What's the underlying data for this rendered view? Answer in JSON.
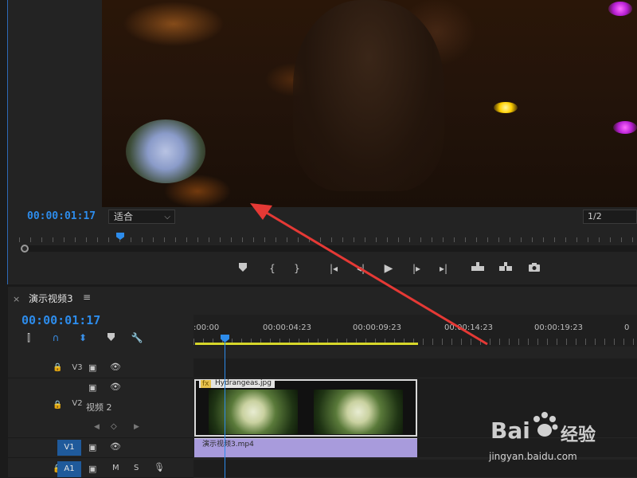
{
  "program_monitor": {
    "timecode": "00:00:01:17",
    "zoom": "适合",
    "resolution": "1/2"
  },
  "timeline": {
    "close": "×",
    "sequence_name": "演示视频3",
    "menu": "≡",
    "timecode": "00:00:01:17",
    "ruler_labels": [
      ":00:00",
      "00:00:04:23",
      "00:00:09:23",
      "00:00:14:23",
      "00:00:19:23",
      "0"
    ],
    "tracks": {
      "v3": "V3",
      "v2": "V2",
      "v2_name": "视频 2",
      "v1": "V1",
      "a1": "A1",
      "a1_mute": "M",
      "a1_solo": "S"
    },
    "clips": {
      "v2_clip": "Hydrangeas.jpg",
      "v2_fx": "fx",
      "v1_clip": "演示视频3.mp4"
    }
  },
  "watermark": {
    "brand": "Bai",
    "brand2": "经验",
    "url": "jingyan.baidu.com"
  },
  "colors": {
    "accent_blue": "#2d8ceb",
    "work_area": "#d6d62a",
    "video_clip": "#a89bdc",
    "arrow": "#e53935"
  }
}
